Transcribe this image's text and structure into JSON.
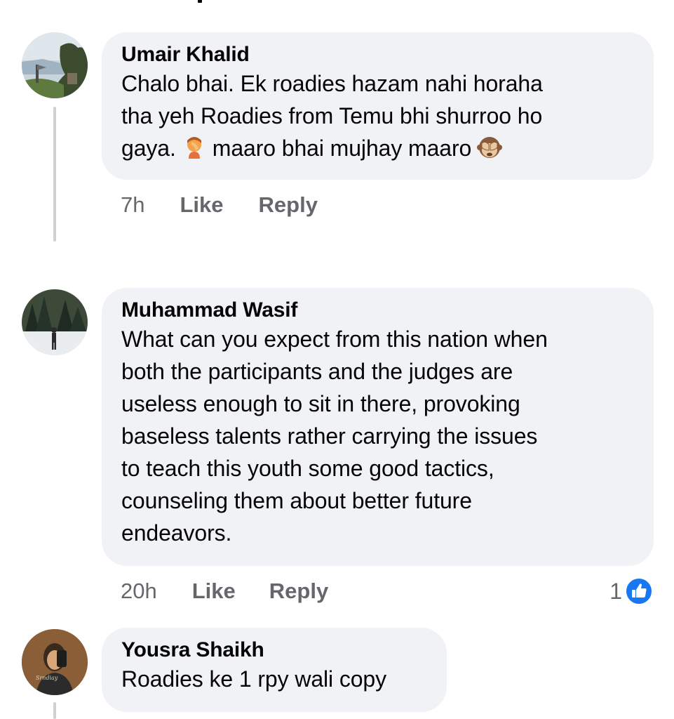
{
  "colors": {
    "bubble_bg": "#f0f2f5",
    "secondary_text": "#65676b",
    "thread_line": "#ced0d4",
    "like_blue": "#1877f2"
  },
  "comments": [
    {
      "author": "Umair Khalid",
      "lines": [
        "Chalo bhai. Ek roadies hazam nahi horaha",
        "tha yeh Roadies from Temu bhi shurroo ho"
      ],
      "last_line_parts": [
        "gaya.",
        "maaro bhai mujhay maaro"
      ],
      "emojis": [
        "facepalm-emoji",
        "see-no-evil-monkey-emoji"
      ],
      "time": "7h",
      "like_label": "Like",
      "reply_label": "Reply",
      "avatar_icon": "landscape-avatar"
    },
    {
      "author": "Muhammad Wasif",
      "lines": [
        "What can you expect from this nation when",
        "both the participants and the judges are",
        "useless enough to sit in there, provoking",
        "baseless talents rather carrying the issues",
        "to teach this youth some good tactics,",
        "counseling them about better future",
        "endeavors."
      ],
      "time": "20h",
      "like_label": "Like",
      "reply_label": "Reply",
      "reaction_count": "1",
      "reaction_icon": "like-thumb-icon",
      "avatar_icon": "snowy-forest-avatar"
    },
    {
      "author": "Yousra Shaikh",
      "lines": [
        "Roadies ke 1 rpy wali copy"
      ],
      "avatar_icon": "selfie-avatar"
    }
  ]
}
